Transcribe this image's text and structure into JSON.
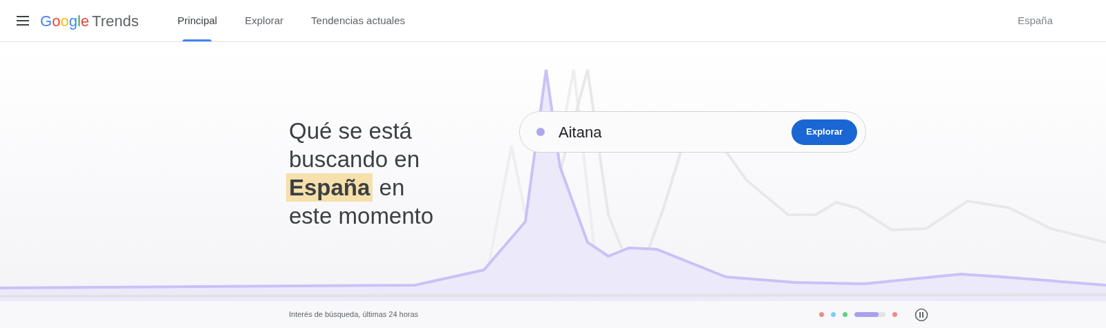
{
  "header": {
    "logo": "Google",
    "product": "Trends",
    "tabs": [
      {
        "label": "Principal",
        "selected": true
      },
      {
        "label": "Explorar",
        "selected": false
      },
      {
        "label": "Tendencias actuales",
        "selected": false
      }
    ],
    "region": "España"
  },
  "hero": {
    "heading": {
      "before": "Qué se está buscando en",
      "highlight": "España",
      "after": "en este momento"
    },
    "search": {
      "color": "#b0a8ee",
      "value": "Aitana",
      "button": "Explorar"
    }
  },
  "footer": {
    "caption": "Interés de búsqueda, últimas 24 horas",
    "slides": [
      {
        "color": "#ee8b85",
        "selected": false
      },
      {
        "color": "#7dcbf7",
        "selected": false
      },
      {
        "color": "#5ed184",
        "selected": false
      },
      {
        "color": "#a9a0ee",
        "selected": true,
        "level": 0.78
      },
      {
        "color": "#ee8b85",
        "selected": false
      }
    ]
  }
}
